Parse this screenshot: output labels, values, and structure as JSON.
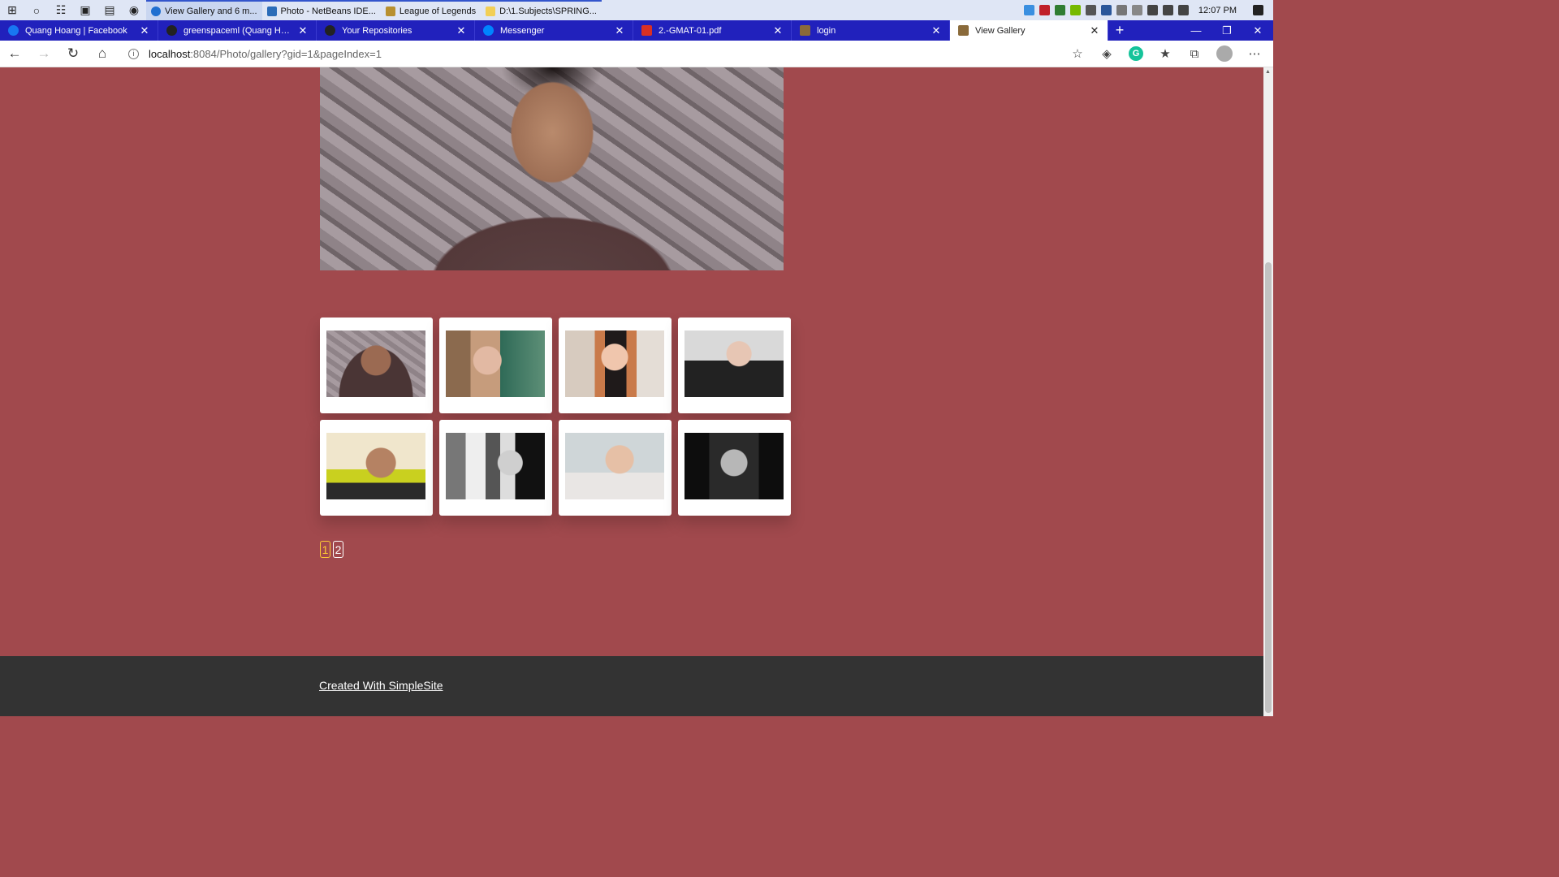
{
  "taskbar": {
    "apps": [
      {
        "label": "View Gallery and 6 m...",
        "state": "active",
        "icon_color": "#1f6fd0"
      },
      {
        "label": "Photo - NetBeans IDE...",
        "state": "open",
        "icon_color": "#2b6cb8"
      },
      {
        "label": "League of Legends",
        "state": "open",
        "icon_color": "#b8902f"
      },
      {
        "label": "D:\\1.Subjects\\SPRING...",
        "state": "open",
        "icon_color": "#f2cf56"
      }
    ],
    "clock": "12:07 PM"
  },
  "tabs": [
    {
      "title": "Quang Hoang | Facebook",
      "icon_color": "#1877f2",
      "active": false
    },
    {
      "title": "greenspaceml (Quang Hoang)",
      "icon_color": "#222222",
      "active": false
    },
    {
      "title": "Your Repositories",
      "icon_color": "#222222",
      "active": false
    },
    {
      "title": "Messenger",
      "icon_color": "#0084ff",
      "active": false
    },
    {
      "title": "2.-GMAT-01.pdf",
      "icon_color": "#d93025",
      "active": false
    },
    {
      "title": "login",
      "icon_color": "#8a6a3a",
      "active": false
    },
    {
      "title": "View Gallery",
      "icon_color": "#8a6a3a",
      "active": true
    }
  ],
  "address": {
    "host": "localhost",
    "path": ":8084/Photo/gallery?gid=1&pageIndex=1"
  },
  "pagination": {
    "pages": [
      "1",
      "2"
    ],
    "current": "1"
  },
  "footer": {
    "link_text": "Created With SimpleSite"
  }
}
